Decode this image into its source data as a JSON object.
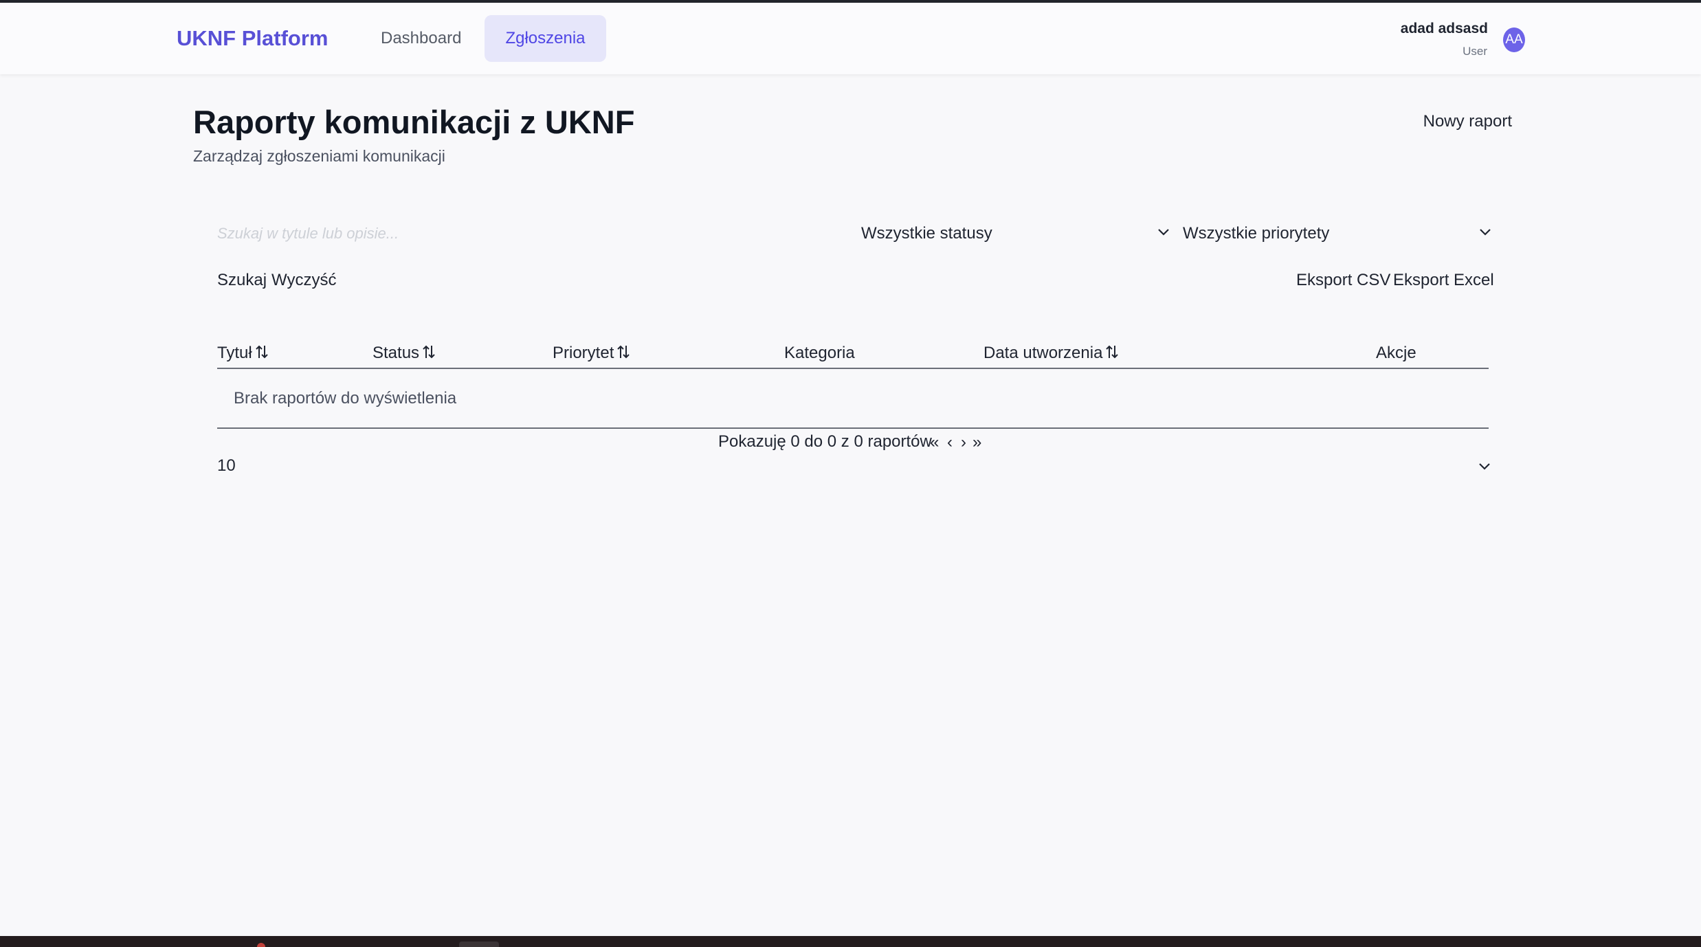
{
  "header": {
    "brand": "UKNF Platform",
    "nav": [
      {
        "label": "Dashboard",
        "active": false
      },
      {
        "label": "Zgłoszenia",
        "active": true
      }
    ],
    "user": {
      "name": "adad adsasd",
      "role": "User",
      "initials": "AA"
    }
  },
  "page": {
    "title": "Raporty komunikacji z UKNF",
    "subtitle": "Zarządzaj zgłoszeniami komunikacji",
    "new_report_label": "Nowy raport"
  },
  "filters": {
    "search_placeholder": "Szukaj w tytule lub opisie...",
    "search_value": "",
    "status_selected": "Wszystkie statusy",
    "priority_selected": "Wszystkie priorytety",
    "search_label": "Szukaj",
    "clear_label": "Wyczyść",
    "export_csv_label": "Eksport CSV",
    "export_excel_label": "Eksport Excel"
  },
  "table": {
    "columns": [
      {
        "label": "Tytuł",
        "sortable": true
      },
      {
        "label": "Status",
        "sortable": true
      },
      {
        "label": "Priorytet",
        "sortable": true
      },
      {
        "label": "Kategoria",
        "sortable": false
      },
      {
        "label": "Data utworzenia",
        "sortable": true
      },
      {
        "label": "Akcje",
        "sortable": false
      }
    ],
    "rows": [],
    "empty_message": "Brak raportów do wyświetlenia"
  },
  "pagination": {
    "info": "Pokazuję 0 do 0 z 0 raportów",
    "first": "«",
    "prev": "‹",
    "next": "›",
    "last": "»",
    "page_size": "10"
  },
  "colors": {
    "brand": "#5850d6",
    "active_nav_bg": "#e6e6fa",
    "active_nav_text": "#4f46e5",
    "avatar_bg": "#6d63e8",
    "page_bg": "#f8f8fa"
  }
}
